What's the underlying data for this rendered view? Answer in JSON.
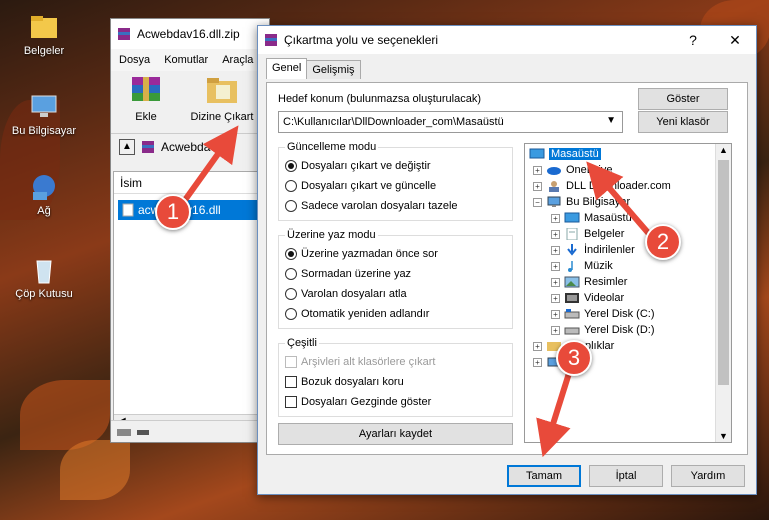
{
  "desktop": {
    "icons": [
      {
        "label": "Belgeler",
        "icon": "folder-icon"
      },
      {
        "label": "Bu Bilgisayar",
        "icon": "computer-icon"
      },
      {
        "label": "Ağ",
        "icon": "network-icon"
      },
      {
        "label": "Çöp Kutusu",
        "icon": "recycle-bin-icon"
      }
    ]
  },
  "winrar": {
    "title": "Acwebdav16.dll.zip",
    "menu": [
      "Dosya",
      "Komutlar",
      "Araçla"
    ],
    "toolbar": {
      "add_label": "Ekle",
      "extract_label": "Dizine Çıkart"
    },
    "address": "Acwebdav",
    "column_name": "İsim",
    "file": "acwebdav16.dll"
  },
  "dialog": {
    "title": "Çıkartma yolu ve seçenekleri",
    "help": "?",
    "close": "✕",
    "tabs": [
      "Genel",
      "Gelişmiş"
    ],
    "dest_label": "Hedef konum (bulunmazsa oluşturulacak)",
    "dest_value": "C:\\Kullanıcılar\\DllDownloader_com\\Masaüstü",
    "show_button": "Göster",
    "new_folder_button": "Yeni klasör",
    "update_mode": {
      "title": "Güncelleme modu",
      "options": [
        "Dosyaları çıkart ve değiştir",
        "Dosyaları çıkart ve güncelle",
        "Sadece varolan dosyaları tazele"
      ],
      "selected": 0
    },
    "overwrite_mode": {
      "title": "Üzerine yaz modu",
      "options": [
        "Üzerine yazmadan önce sor",
        "Sormadan üzerine yaz",
        "Varolan dosyaları atla",
        "Otomatik yeniden adlandır"
      ],
      "selected": 0
    },
    "misc": {
      "title": "Çeşitli",
      "options": [
        "Arşivleri alt klasörlere çıkart",
        "Bozuk dosyaları koru",
        "Dosyaları Gezginde göster"
      ]
    },
    "save_settings": "Ayarları kaydet",
    "tree": [
      {
        "label": "Masaüstü",
        "level": 0,
        "selected": true,
        "icon": "desktop-icon"
      },
      {
        "label": "OneDrive",
        "level": 1,
        "icon": "cloud-icon"
      },
      {
        "label": "DLL Downloader.com",
        "level": 1,
        "icon": "user-icon"
      },
      {
        "label": "Bu Bilgisayar",
        "level": 1,
        "icon": "computer-icon"
      },
      {
        "label": "Masaüstü",
        "level": 2,
        "icon": "desktop-icon"
      },
      {
        "label": "Belgeler",
        "level": 2,
        "icon": "documents-icon"
      },
      {
        "label": "İndirilenler",
        "level": 2,
        "icon": "download-icon"
      },
      {
        "label": "Müzik",
        "level": 2,
        "icon": "music-icon"
      },
      {
        "label": "Resimler",
        "level": 2,
        "icon": "pictures-icon"
      },
      {
        "label": "Videolar",
        "level": 2,
        "icon": "videos-icon"
      },
      {
        "label": "Yerel Disk (C:)",
        "level": 2,
        "icon": "disk-icon"
      },
      {
        "label": "Yerel Disk (D:)",
        "level": 2,
        "icon": "disk-icon"
      },
      {
        "label": "Kitaplıklar",
        "level": 1,
        "icon": "library-icon"
      },
      {
        "label": "Ağ",
        "level": 1,
        "icon": "network-icon"
      }
    ],
    "ok": "Tamam",
    "cancel": "İptal",
    "help_button": "Yardım"
  },
  "annotations": [
    "1",
    "2",
    "3"
  ],
  "colors": {
    "accent": "#0078d7",
    "arrow": "#e84a3a"
  }
}
